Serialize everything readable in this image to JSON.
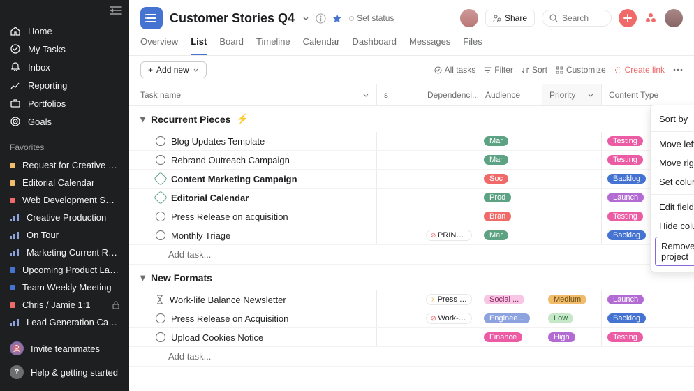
{
  "sidebar": {
    "nav": [
      {
        "icon": "home",
        "label": "Home"
      },
      {
        "icon": "check",
        "label": "My Tasks"
      },
      {
        "icon": "bell",
        "label": "Inbox"
      },
      {
        "icon": "chart",
        "label": "Reporting"
      },
      {
        "icon": "briefcase",
        "label": "Portfolios"
      },
      {
        "icon": "target",
        "label": "Goals"
      }
    ],
    "favorites_header": "Favorites",
    "favorites": [
      {
        "type": "dot",
        "color": "#f1bd6c",
        "label": "Request for Creative Pro..."
      },
      {
        "type": "dot",
        "color": "#f1bd6c",
        "label": "Editorial Calendar"
      },
      {
        "type": "dot",
        "color": "#f06a6a",
        "label": "Web Development Sprint..."
      },
      {
        "type": "bars",
        "color": "#8da3e0",
        "label": "Creative Production"
      },
      {
        "type": "bars",
        "color": "#8da3e0",
        "label": "On Tour"
      },
      {
        "type": "bars",
        "color": "#8da3e0",
        "label": "Marketing Current Road..."
      },
      {
        "type": "dot",
        "color": "#4573d2",
        "label": "Upcoming Product Laun..."
      },
      {
        "type": "dot",
        "color": "#4573d2",
        "label": "Team Weekly Meeting"
      },
      {
        "type": "dot",
        "color": "#f06a6a",
        "label": "Chris / Jamie 1:1",
        "locked": true
      },
      {
        "type": "bars",
        "color": "#8da3e0",
        "label": "Lead Generation Campai..."
      }
    ],
    "invite": "Invite teammates",
    "help": "Help & getting started"
  },
  "header": {
    "title": "Customer Stories Q4",
    "set_status": "Set status",
    "share": "Share",
    "search_placeholder": "Search"
  },
  "tabs": [
    "Overview",
    "List",
    "Board",
    "Timeline",
    "Calendar",
    "Dashboard",
    "Messages",
    "Files"
  ],
  "active_tab": "List",
  "toolbar": {
    "add_new": "Add new",
    "all_tasks": "All tasks",
    "filter": "Filter",
    "sort": "Sort",
    "customize": "Customize",
    "create_link": "Create link"
  },
  "columns": [
    "Task name",
    "s",
    "Dependenci...",
    "Audience",
    "Priority",
    "Content Type"
  ],
  "sections": [
    {
      "name": "Recurrent Pieces",
      "bolt": true,
      "tasks": [
        {
          "name": "Blog Updates Template",
          "audience": {
            "text": "Mar",
            "color": "#5da283",
            "fg": "#fff"
          },
          "content": {
            "text": "Testing",
            "color": "#ec5ca4",
            "fg": "#fff"
          }
        },
        {
          "name": "Rebrand Outreach Campaign",
          "audience": {
            "text": "Mar",
            "color": "#5da283",
            "fg": "#fff"
          },
          "content": {
            "text": "Testing",
            "color": "#ec5ca4",
            "fg": "#fff"
          }
        },
        {
          "name": "Content Marketing Campaign",
          "milestone": true,
          "bold": true,
          "audience": {
            "text": "Soc",
            "color": "#f06a6a",
            "fg": "#fff"
          },
          "content": {
            "text": "Backlog",
            "color": "#4573d2",
            "fg": "#fff"
          }
        },
        {
          "name": "Editorial Calendar",
          "milestone": true,
          "bold": true,
          "audience": {
            "text": "Prod",
            "color": "#5da283",
            "fg": "#fff"
          },
          "content": {
            "text": "Launch",
            "color": "#b36bd4",
            "fg": "#fff"
          }
        },
        {
          "name": "Press Release on acquisition",
          "audience": {
            "text": "Bran",
            "color": "#f06a6a",
            "fg": "#fff"
          },
          "content": {
            "text": "Testing",
            "color": "#ec5ca4",
            "fg": "#fff"
          }
        },
        {
          "name": "Monthly Triage",
          "dep": {
            "text": "PRINT - R...",
            "blocked": true
          },
          "audience": {
            "text": "Mar",
            "color": "#5da283",
            "fg": "#fff"
          },
          "content": {
            "text": "Backlog",
            "color": "#4573d2",
            "fg": "#fff"
          }
        }
      ],
      "add": "Add task..."
    },
    {
      "name": "New Formats",
      "tasks": [
        {
          "name": "Work-life Balance Newsletter",
          "icon": "hourglass",
          "dep": {
            "text": "Press Rele...",
            "wait": true
          },
          "audience": {
            "text": "Social ...",
            "color": "#f8c6e4",
            "fg": "#8a2a63"
          },
          "priority": {
            "text": "Medium",
            "color": "#f1bd6c",
            "fg": "#6b4a12"
          },
          "content": {
            "text": "Launch",
            "color": "#b36bd4",
            "fg": "#fff"
          }
        },
        {
          "name": "Press Release on Acquisition",
          "dep": {
            "text": "Work-life ...",
            "blocked": true
          },
          "audience": {
            "text": "Enginee...",
            "color": "#8da3e0",
            "fg": "#fff"
          },
          "priority": {
            "text": "Low",
            "color": "#c6e7c8",
            "fg": "#2e6b3d"
          },
          "content": {
            "text": "Backlog",
            "color": "#4573d2",
            "fg": "#fff"
          }
        },
        {
          "name": "Upload Cookies Notice",
          "audience": {
            "text": "Finance",
            "color": "#ec5ca4",
            "fg": "#fff"
          },
          "priority": {
            "text": "High",
            "color": "#b36bd4",
            "fg": "#fff"
          },
          "content": {
            "text": "Testing",
            "color": "#ec5ca4",
            "fg": "#fff"
          }
        }
      ],
      "add": "Add task..."
    }
  ],
  "dropdown": {
    "items": [
      {
        "label": "Sort by"
      },
      {
        "sep": true
      },
      {
        "label": "Move left"
      },
      {
        "label": "Move right"
      },
      {
        "label": "Set column width",
        "chevron": true
      },
      {
        "sep": true
      },
      {
        "label": "Edit field"
      },
      {
        "label": "Hide column"
      },
      {
        "label": "Remove field from project",
        "highlight": true
      }
    ]
  }
}
